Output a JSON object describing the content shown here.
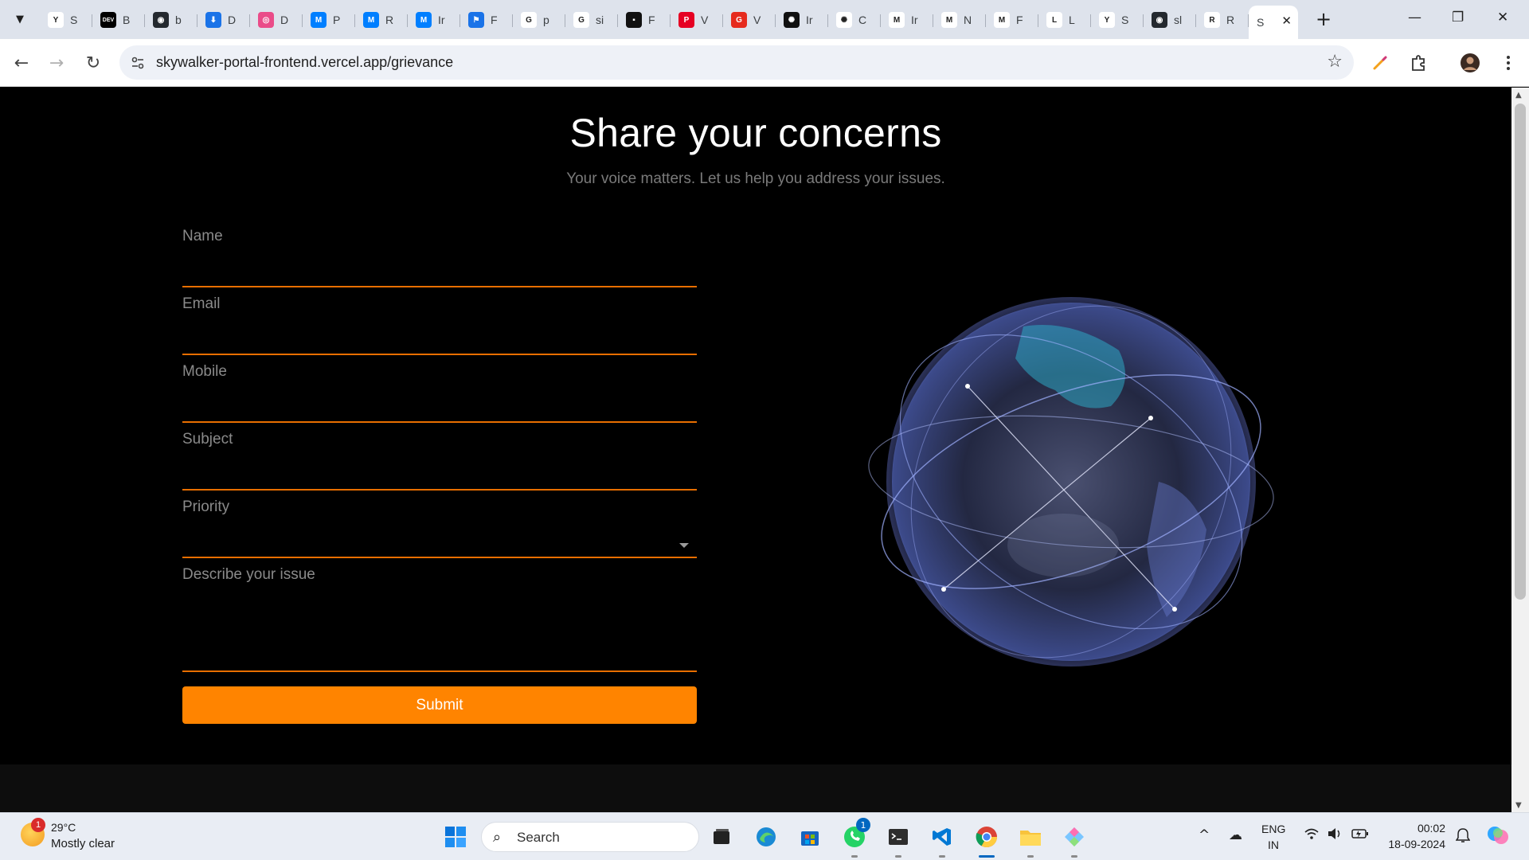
{
  "browser": {
    "tabs": [
      {
        "icon": "y-combinator-icon",
        "title": "S",
        "color": "#ffffff",
        "glyph": "Y"
      },
      {
        "icon": "dev-icon",
        "title": "B",
        "color": "#000000",
        "glyph": "DEV"
      },
      {
        "icon": "github-icon",
        "title": "b",
        "color": "#24292f",
        "glyph": "◉"
      },
      {
        "icon": "download-icon",
        "title": "D",
        "color": "#1a73e8",
        "glyph": "⬇"
      },
      {
        "icon": "dribbble-icon",
        "title": "D",
        "color": "#ea4c89",
        "glyph": "◎"
      },
      {
        "icon": "mui-icon",
        "title": "P",
        "color": "#007fff",
        "glyph": "M"
      },
      {
        "icon": "mui-icon",
        "title": "R",
        "color": "#007fff",
        "glyph": "M"
      },
      {
        "icon": "mui-icon",
        "title": "Ir",
        "color": "#007fff",
        "glyph": "M"
      },
      {
        "icon": "flag-icon",
        "title": "F",
        "color": "#1a73e8",
        "glyph": "⚑"
      },
      {
        "icon": "google-icon",
        "title": "p",
        "color": "#ffffff",
        "glyph": "G"
      },
      {
        "icon": "google-icon",
        "title": "si",
        "color": "#ffffff",
        "glyph": "G"
      },
      {
        "icon": "notion-icon",
        "title": "F",
        "color": "#111111",
        "glyph": "▪"
      },
      {
        "icon": "pinterest-icon",
        "title": "V",
        "color": "#e60023",
        "glyph": "P"
      },
      {
        "icon": "g2-icon",
        "title": "V",
        "color": "#e62b1e",
        "glyph": "G"
      },
      {
        "icon": "openai-icon",
        "title": "Ir",
        "color": "#111111",
        "glyph": "✺"
      },
      {
        "icon": "openai-icon",
        "title": "C",
        "color": "#ffffff",
        "glyph": "✺"
      },
      {
        "icon": "gmail-icon",
        "title": "Ir",
        "color": "#ffffff",
        "glyph": "M"
      },
      {
        "icon": "gmail-icon",
        "title": "N",
        "color": "#ffffff",
        "glyph": "M"
      },
      {
        "icon": "gmail-icon",
        "title": "F",
        "color": "#ffffff",
        "glyph": "M"
      },
      {
        "icon": "l-icon",
        "title": "L",
        "color": "#ffffff",
        "glyph": "L"
      },
      {
        "icon": "y-combinator-icon",
        "title": "S",
        "color": "#ffffff",
        "glyph": "Y"
      },
      {
        "icon": "github-icon",
        "title": "sl",
        "color": "#24292f",
        "glyph": "◉"
      },
      {
        "icon": "render-icon",
        "title": "R",
        "color": "#ffffff",
        "glyph": "R"
      }
    ],
    "active_tab": {
      "title": "S",
      "close": "✕"
    },
    "new_tab": "+",
    "window_controls": {
      "minimize": "—",
      "restore": "❐",
      "close": "✕"
    },
    "url": "skywalker-portal-frontend.vercel.app/grievance"
  },
  "page": {
    "title": "Share your concerns",
    "subtitle": "Your voice matters. Let us help you address your issues.",
    "form": {
      "name_label": "Name",
      "email_label": "Email",
      "mobile_label": "Mobile",
      "subject_label": "Subject",
      "priority_label": "Priority",
      "priority_value": "",
      "description_label": "Describe your issue",
      "submit_label": "Submit"
    },
    "colors": {
      "accent": "#ff8400",
      "underline": "#e86e00",
      "background": "#000000"
    }
  },
  "taskbar": {
    "weather": {
      "temp": "29°C",
      "desc": "Mostly clear",
      "badge": "1"
    },
    "search_placeholder": "Search",
    "whatsapp_badge": "1",
    "lang_line1": "ENG",
    "lang_line2": "IN",
    "time": "00:02",
    "date": "18-09-2024"
  }
}
